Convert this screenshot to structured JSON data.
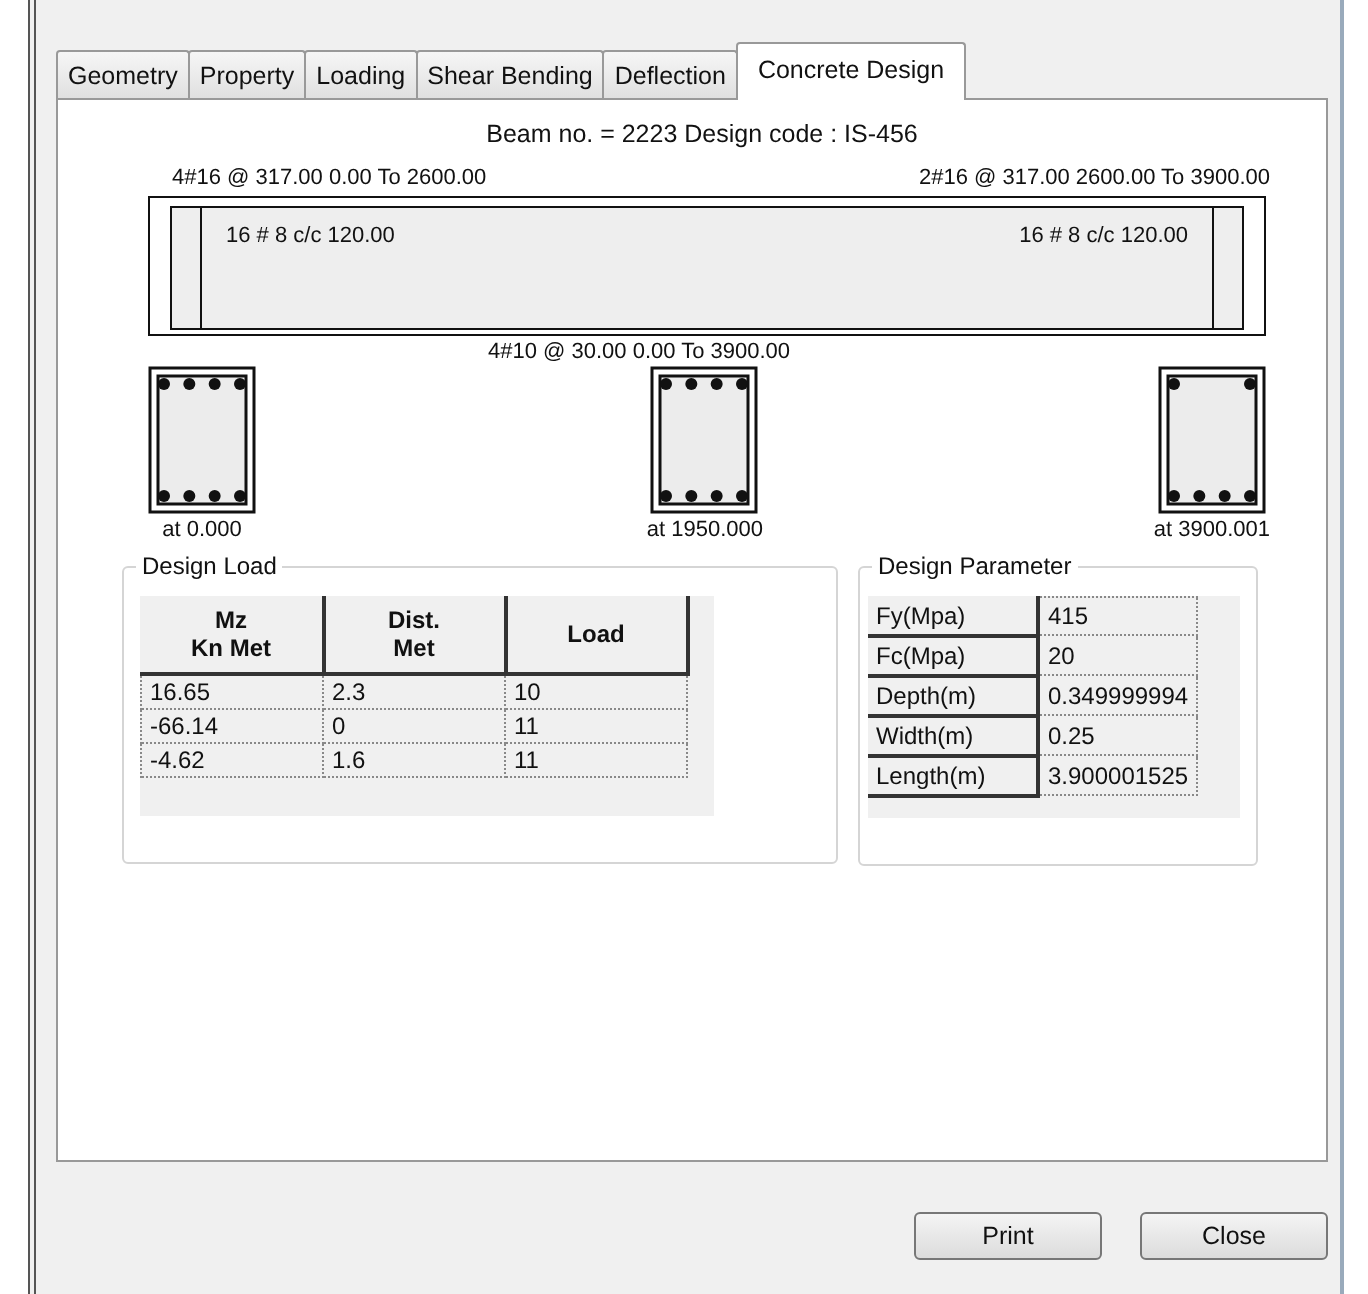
{
  "tabs": [
    {
      "label": "Geometry",
      "selected": false
    },
    {
      "label": "Property",
      "selected": false
    },
    {
      "label": "Loading",
      "selected": false
    },
    {
      "label": "Shear Bending",
      "selected": false
    },
    {
      "label": "Deflection",
      "selected": false
    },
    {
      "label": "Concrete Design",
      "selected": true
    }
  ],
  "heading": "Beam no. = 2223  Design code :  IS-456",
  "beam": {
    "top_left": "4#16 @ 317.00 0.00 To 2600.00",
    "top_right": "2#16 @ 317.00 2600.00 To 3900.00",
    "stirrup_left": "16 # 8 c/c 120.00",
    "stirrup_right": "16 # 8 c/c 120.00",
    "bottom": "4#10 @ 30.00 0.00 To 3900.00"
  },
  "sections": [
    {
      "kind": "full",
      "label": "at 0.000"
    },
    {
      "kind": "full",
      "label": "at 1950.000"
    },
    {
      "kind": "corner",
      "label": "at 3900.001"
    }
  ],
  "design_load": {
    "title": "Design Load",
    "columns": [
      "Mz\nKn Met",
      "Dist.\nMet",
      "Load"
    ],
    "rows": [
      [
        "16.65",
        "2.3",
        "10"
      ],
      [
        "-66.14",
        "0",
        "11"
      ],
      [
        "-4.62",
        "1.6",
        "11"
      ]
    ]
  },
  "design_parameter": {
    "title": "Design Parameter",
    "rows": [
      [
        "Fy(Mpa)",
        "415"
      ],
      [
        "Fc(Mpa)",
        "20"
      ],
      [
        "Depth(m)",
        "0.349999994"
      ],
      [
        "Width(m)",
        "0.25"
      ],
      [
        "Length(m)",
        "3.900001525"
      ]
    ]
  },
  "buttons": [
    "Print",
    "Close"
  ]
}
